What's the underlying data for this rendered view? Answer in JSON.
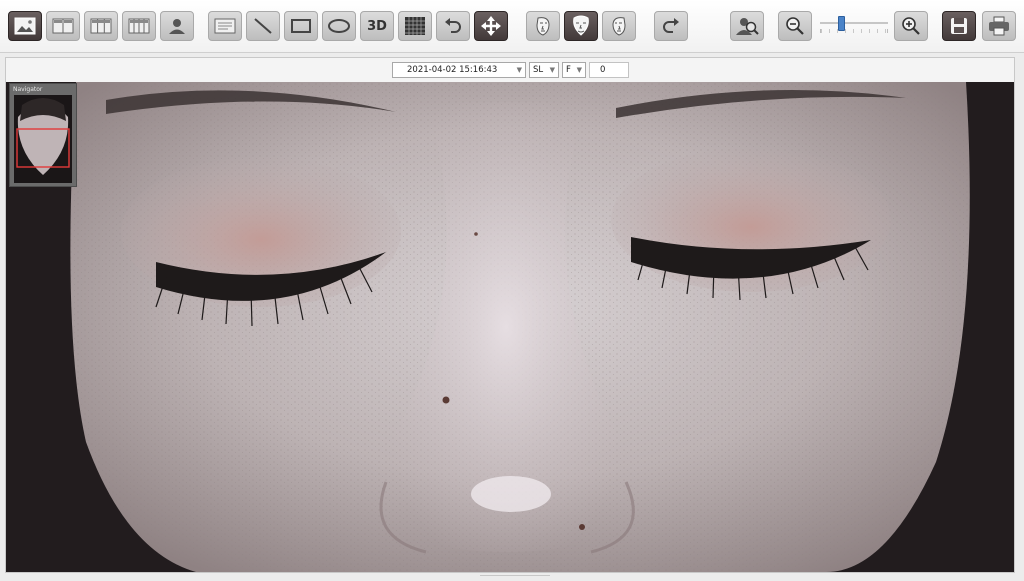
{
  "toolbar": {
    "buttons": [
      {
        "name": "single-view",
        "icon": "image-icon"
      },
      {
        "name": "dual-view",
        "icon": "split-2-icon"
      },
      {
        "name": "triple-view",
        "icon": "split-3-icon"
      },
      {
        "name": "quad-view",
        "icon": "split-4-icon"
      },
      {
        "name": "profile",
        "icon": "user-icon"
      },
      {
        "name": "text-note",
        "icon": "text-box-icon"
      },
      {
        "name": "line-tool",
        "icon": "line-icon"
      },
      {
        "name": "rectangle-tool",
        "icon": "rectangle-icon"
      },
      {
        "name": "ellipse-tool",
        "icon": "ellipse-icon"
      },
      {
        "name": "view-3d",
        "icon": "3d-icon",
        "label": "3D"
      },
      {
        "name": "grid-tool",
        "icon": "grid-icon"
      },
      {
        "name": "undo",
        "icon": "undo-icon"
      },
      {
        "name": "pan-tool",
        "icon": "move-icon",
        "active": true
      },
      {
        "name": "face-left",
        "icon": "face-left-icon"
      },
      {
        "name": "face-front",
        "icon": "face-front-icon",
        "active": true
      },
      {
        "name": "face-right",
        "icon": "face-right-icon"
      },
      {
        "name": "redo",
        "icon": "redo-icon"
      },
      {
        "name": "zoom-to-fit",
        "icon": "zoom-person-icon"
      },
      {
        "name": "zoom-out",
        "icon": "zoom-out-icon"
      },
      {
        "name": "zoom-in",
        "icon": "zoom-in-icon"
      },
      {
        "name": "save",
        "icon": "save-icon"
      },
      {
        "name": "print",
        "icon": "print-icon"
      }
    ],
    "zoom_level": 0.3
  },
  "filters": {
    "date": "2021-04-02 15:16:43",
    "mode": "SL",
    "view": "F",
    "extra": "0"
  },
  "navigator": {
    "title": "Navigator"
  },
  "colors": {
    "accent": "#4a83c8",
    "active_button": "#4a4040",
    "navigator_frame": "#e23a3a"
  }
}
